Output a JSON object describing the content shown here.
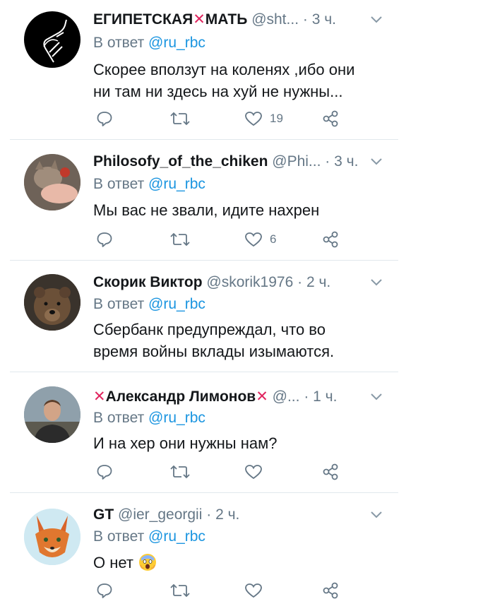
{
  "tweets": [
    {
      "name": "ЕГИПЕТСКАЯ",
      "name_x": "✕",
      "name_after": "МАТЬ",
      "handle": "@sht...",
      "time": "· 3 ч.",
      "reply_prefix": "В ответ",
      "reply_to": "@ru_rbc",
      "text_lines": [
        "Скорее вползут на коленях ,ибо они",
        "ни там ни здесь на хуй не нужны..."
      ],
      "likes": "19"
    },
    {
      "name": "Philosofy_of_the_chiken",
      "handle": "@Phi...",
      "time": "· 3 ч.",
      "reply_prefix": "В ответ",
      "reply_to": "@ru_rbc",
      "text_lines": [
        "Мы вас не звали, идите нахрен"
      ],
      "likes": "6"
    },
    {
      "name": "Скорик Виктор",
      "handle": "@skorik1976",
      "time": "· 2 ч.",
      "reply_prefix": "В ответ",
      "reply_to": "@ru_rbc",
      "text_lines": [
        "Сбербанк предупреждал, что во",
        "время войны вклады изымаются."
      ],
      "likes": ""
    },
    {
      "name": "Александр Лимонов",
      "name_x": "✕",
      "handle": "@...",
      "time": "· 1 ч.",
      "reply_prefix": "В ответ",
      "reply_to": "@ru_rbc",
      "text_lines": [
        "И на хер они нужны нам?"
      ],
      "likes": ""
    },
    {
      "name": "GT",
      "handle": "@ier_georgii",
      "time": "· 2 ч.",
      "reply_prefix": "В ответ",
      "reply_to": "@ru_rbc",
      "text_lines": [
        "О нет"
      ],
      "likes": ""
    }
  ],
  "colors": {
    "text": "#14171a",
    "secondary": "#657786",
    "mention": "#1b95e0",
    "x_mark": "#e0245e",
    "divider": "#e1e8ed"
  },
  "icons": [
    "reply-icon",
    "retweet-icon",
    "like-icon",
    "share-icon",
    "chevron-down-icon",
    "screaming-face-emoji"
  ]
}
